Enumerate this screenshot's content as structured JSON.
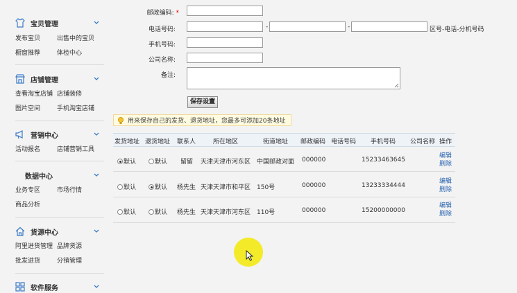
{
  "sidebar": {
    "sections": [
      {
        "title": "宝贝管理",
        "icon": "shirt-icon",
        "links": [
          "发布宝贝",
          "出售中的宝贝",
          "橱窗推荐",
          "体检中心"
        ]
      },
      {
        "title": "店铺管理",
        "icon": "store-icon",
        "links": [
          "查看淘宝店铺",
          "店铺装修",
          "图片空间",
          "手机淘宝店铺"
        ]
      },
      {
        "title": "营销中心",
        "icon": "megaphone-icon",
        "links": [
          "活动报名",
          "店铺营销工具"
        ]
      },
      {
        "title": "数据中心",
        "icon": "",
        "links": [
          "业务专区",
          "市场行情",
          "商品分析"
        ]
      },
      {
        "title": "货源中心",
        "icon": "home-icon",
        "links": [
          "阿里进货管理",
          "品牌货源",
          "批发进货",
          "分销管理"
        ]
      },
      {
        "title": "软件服务",
        "icon": "grid-icon",
        "links": []
      }
    ]
  },
  "form": {
    "postcode_label": "邮政编码:",
    "required_mark": "*",
    "phone_label": "电话号码:",
    "phone_sep": "-",
    "phone_hint": "区号-电话-分机号码",
    "mobile_label": "手机号码:",
    "company_label": "公司名称:",
    "remark_label": "备注:",
    "save_button": "保存设置",
    "tip": "用来保存自己的发货、退货地址，您最多可添加20条地址"
  },
  "table": {
    "headers": [
      "发货地址",
      "退货地址",
      "联系人",
      "所在地区",
      "街道地址",
      "邮政编码",
      "电话号码",
      "手机号码",
      "公司名称",
      "操作"
    ],
    "default_label": "默认",
    "edit_label": "编辑",
    "delete_label": "删除",
    "rows": [
      {
        "ship_default": true,
        "return_default": false,
        "contact": "留留",
        "region": "天津天津市河东区",
        "street": "中国邮政对面",
        "postcode": "000000",
        "phone": "",
        "mobile": "15233463645",
        "company": ""
      },
      {
        "ship_default": false,
        "return_default": true,
        "contact": "杨先生",
        "region": "天津天津市和平区",
        "street": "150号",
        "postcode": "000000",
        "phone": "",
        "mobile": "13233334444",
        "company": ""
      },
      {
        "ship_default": false,
        "return_default": false,
        "contact": "杨先生",
        "region": "天津天津市河东区",
        "street": "110号",
        "postcode": "000000",
        "phone": "",
        "mobile": "15200000000",
        "company": ""
      }
    ]
  },
  "colors": {
    "accent_blue": "#2a64b0",
    "cursor_highlight": "#f3ea2a"
  }
}
